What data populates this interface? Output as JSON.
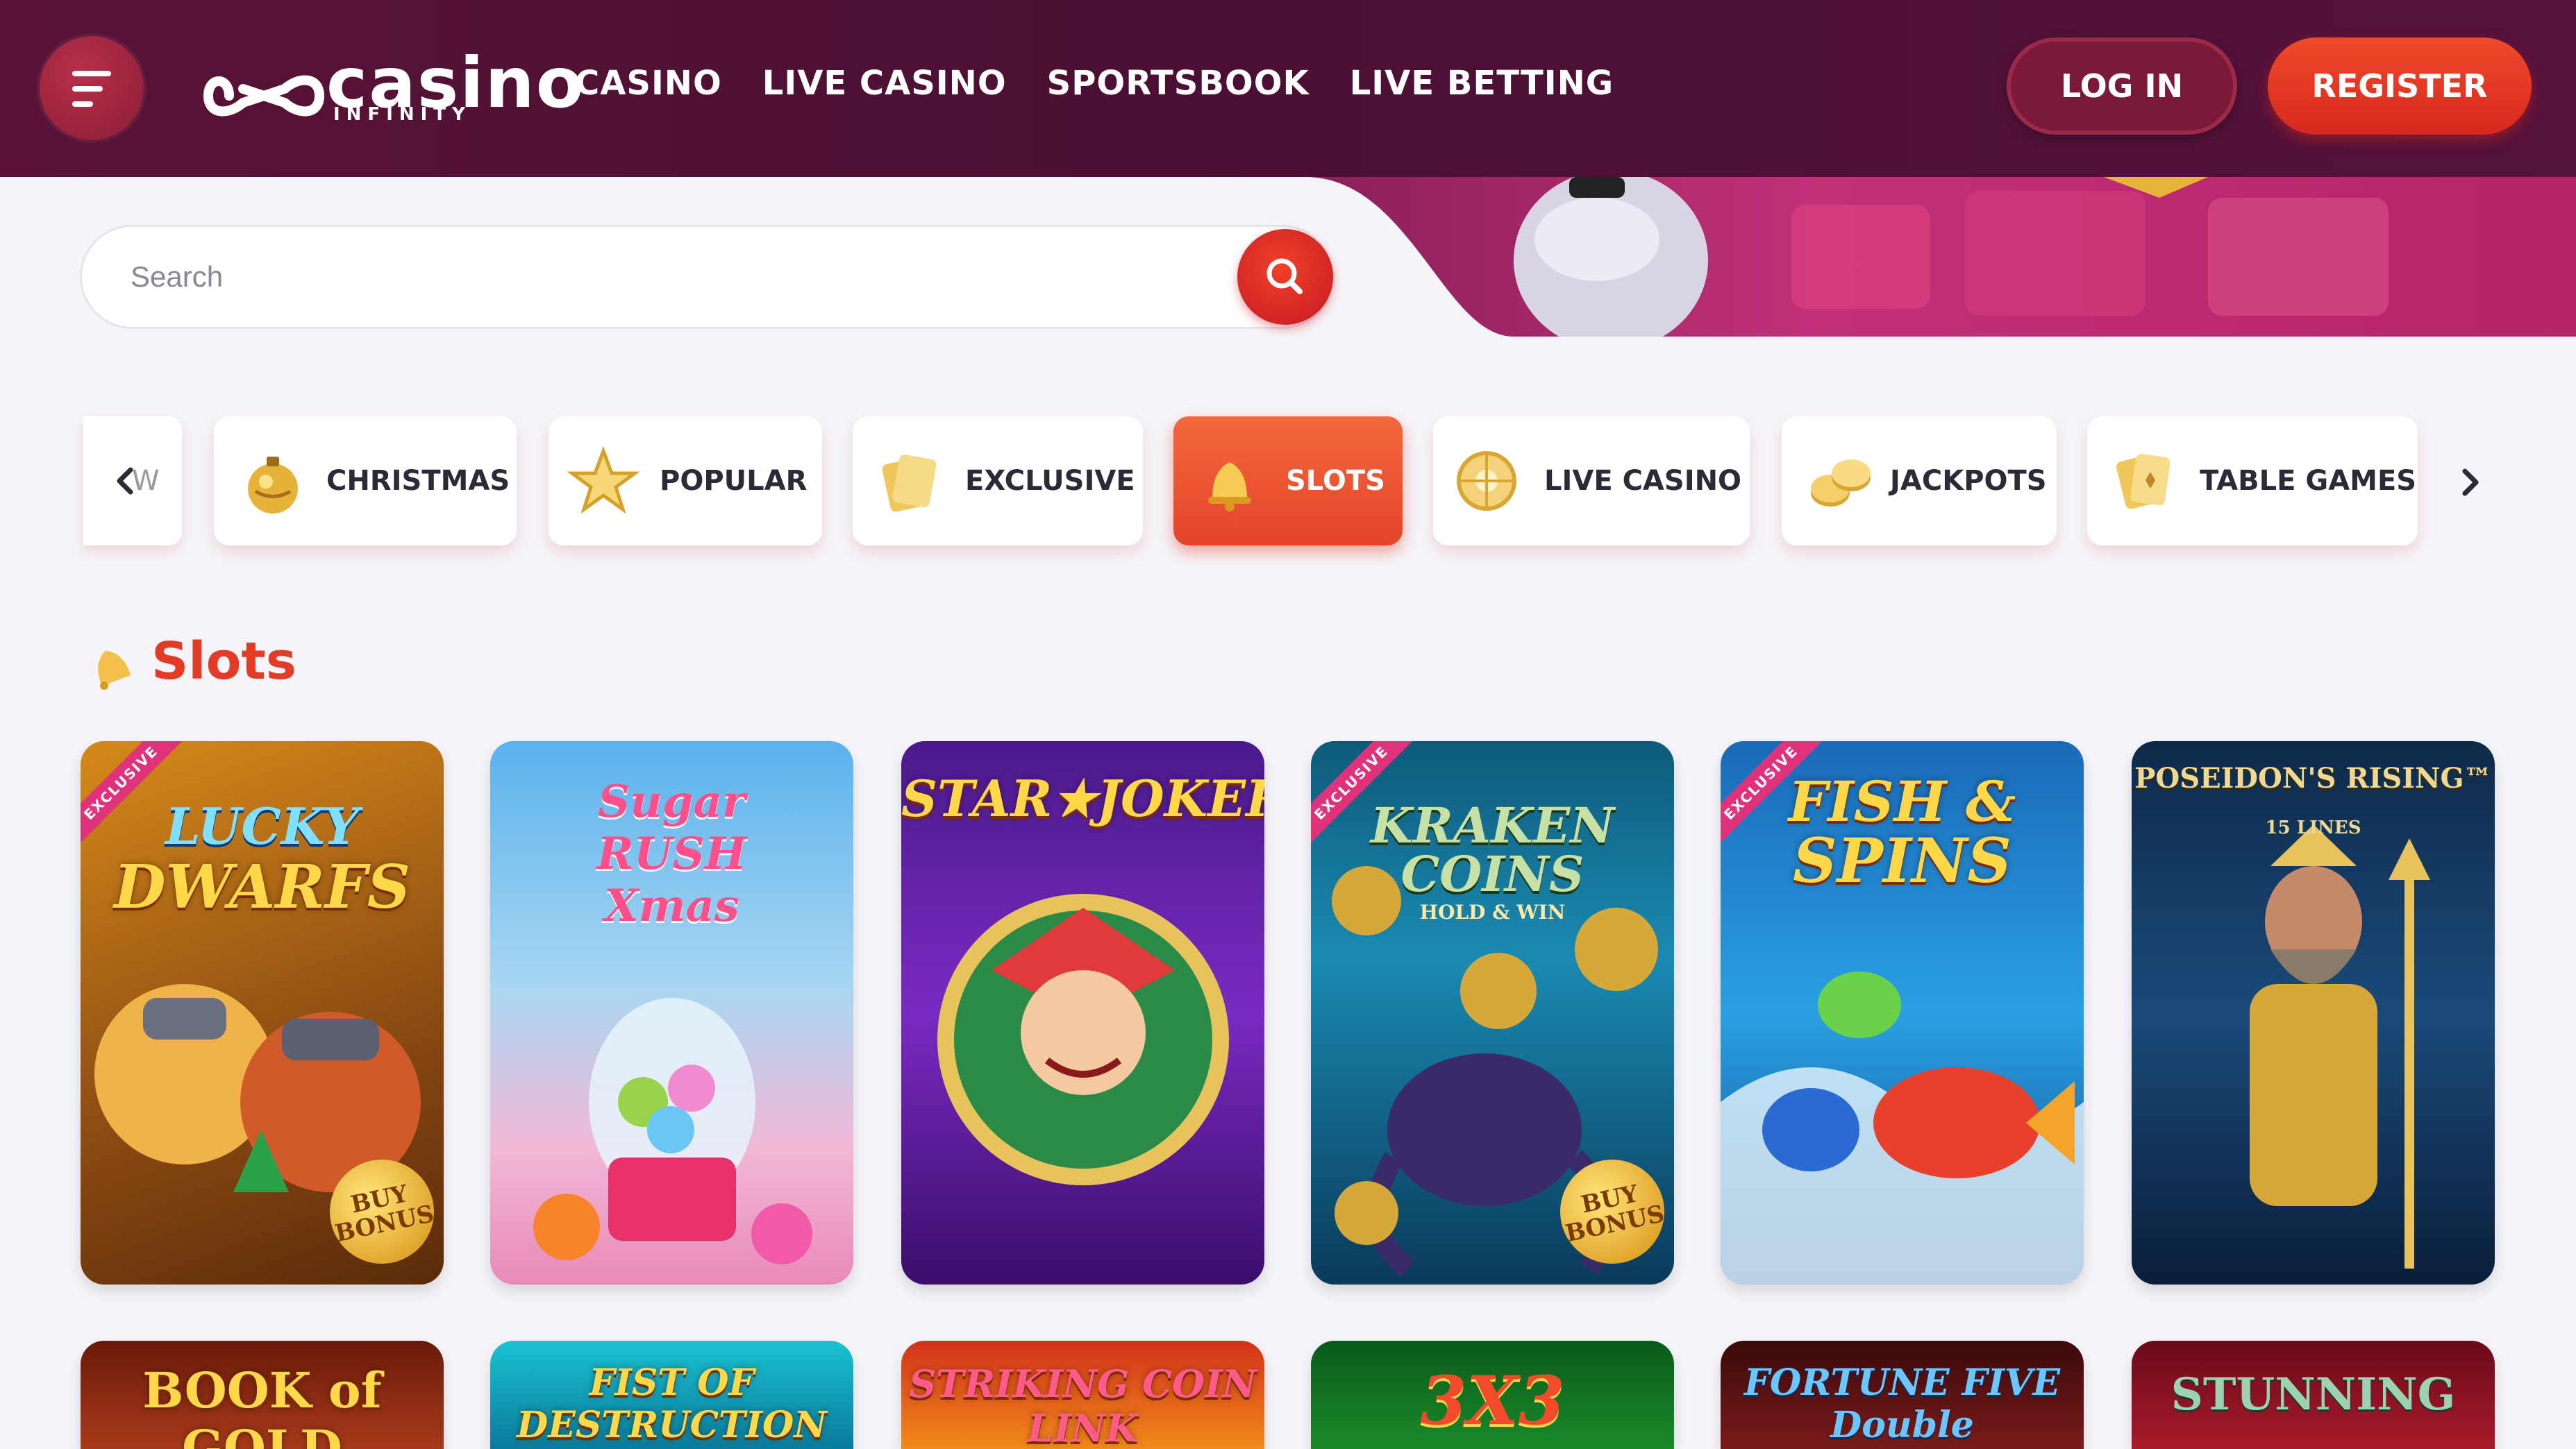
{
  "header": {
    "logo_word": "casino",
    "logo_sub": "INFINITY",
    "nav": [
      "CASINO",
      "LIVE CASINO",
      "SPORTSBOOK",
      "LIVE BETTING"
    ],
    "login_label": "LOG IN",
    "register_label": "REGISTER"
  },
  "search": {
    "placeholder": "Search",
    "value": ""
  },
  "categories": {
    "partial_left": "W",
    "items": [
      {
        "label": "CHRISTMAS",
        "icon": "christmas-ornament-icon",
        "active": false
      },
      {
        "label": "POPULAR",
        "icon": "star-icon",
        "active": false
      },
      {
        "label": "EXCLUSIVE",
        "icon": "exclusive-cards-icon",
        "active": false
      },
      {
        "label": "SLOTS",
        "icon": "bell-icon",
        "active": true
      },
      {
        "label": "LIVE CASINO",
        "icon": "roulette-icon",
        "active": false
      },
      {
        "label": "JACKPOTS",
        "icon": "coins-icon",
        "active": false
      },
      {
        "label": "TABLE GAMES",
        "icon": "playing-cards-icon",
        "active": false
      }
    ]
  },
  "section": {
    "title": "Slots",
    "icon": "bell-icon"
  },
  "games_row1": [
    {
      "title_line1": "LUCKY",
      "title_line2": "DWARFS",
      "exclusive": true,
      "badge_line1": "BUY",
      "badge_line2": "BONUS"
    },
    {
      "title_line1": "Sugar",
      "title_line2": "RUSH",
      "title_line3": "Xmas",
      "exclusive": false
    },
    {
      "title_line1": "STAR★JOKER",
      "exclusive": false
    },
    {
      "title_line1": "KRAKEN",
      "title_line2": "COINS",
      "title_line3": "HOLD & WIN",
      "exclusive": true,
      "badge_line1": "BUY",
      "badge_line2": "BONUS"
    },
    {
      "title_line1": "FISH &",
      "title_line2": "SPINS",
      "exclusive": true
    },
    {
      "title_line1": "POSEIDON'S RISING™",
      "title_line2": "15 LINES",
      "exclusive": false
    }
  ],
  "games_row2": [
    {
      "title": "BOOK of GOLD"
    },
    {
      "title": "FIST OF DESTRUCTION"
    },
    {
      "title": "STRIKING COIN LINK"
    },
    {
      "title": "3X3"
    },
    {
      "title": "FORTUNE FIVE Double"
    },
    {
      "title": "STUNNING"
    }
  ],
  "exclusive_label": "EXCLUSIVE",
  "colors": {
    "header_bg": "#4a0f33",
    "accent_red": "#e33b26",
    "active_category": "#e4442b",
    "page_bg": "#f5f4f8"
  }
}
